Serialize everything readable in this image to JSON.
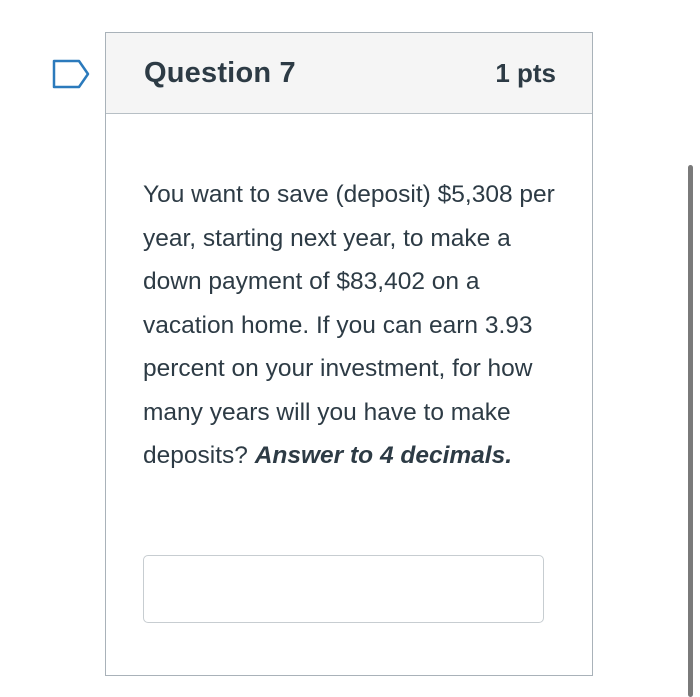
{
  "question": {
    "title": "Question 7",
    "points": "1 pts",
    "text": "You want to save (deposit) $5,308 per year, starting next year, to make a down payment of $83,402 on a vacation home. If you can earn 3.93 percent on your investment, for how many years will you have to make deposits?",
    "instruction": "Answer to 4 decimals.",
    "answer_value": ""
  },
  "icons": {
    "flag": "bookmark-flag-icon"
  },
  "colors": {
    "text": "#2d3b45",
    "flag": "#2b7abc",
    "header_bg": "#f5f5f5",
    "border": "#a9b2b9"
  }
}
